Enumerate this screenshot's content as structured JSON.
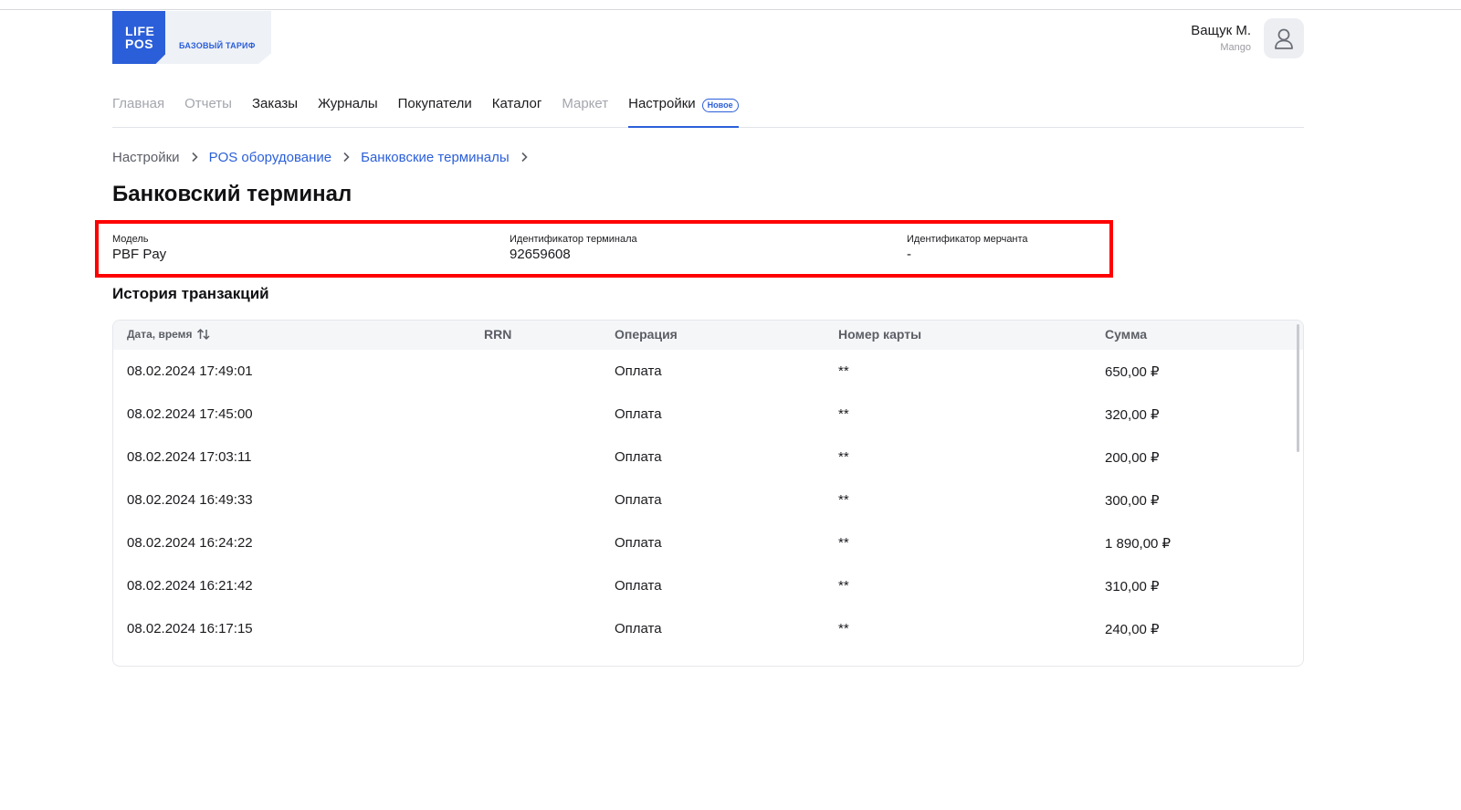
{
  "logo": {
    "line1": "LIFE",
    "line2": "POS",
    "tariff": "БАЗОВЫЙ ТАРИФ"
  },
  "user": {
    "name": "Ващук М.",
    "company": "Mango"
  },
  "nav": {
    "items": [
      {
        "label": "Главная"
      },
      {
        "label": "Отчеты"
      },
      {
        "label": "Заказы"
      },
      {
        "label": "Журналы"
      },
      {
        "label": "Покупатели"
      },
      {
        "label": "Каталог"
      },
      {
        "label": "Маркет"
      },
      {
        "label": "Настройки",
        "badge": "Новое"
      }
    ]
  },
  "breadcrumbs": [
    "Настройки",
    "POS оборудование",
    "Банковские терминалы"
  ],
  "page_title": "Банковский терминал",
  "info": {
    "model_label": "Модель",
    "model_value": "PBF Pay",
    "terminal_label": "Идентификатор терминала",
    "terminal_value": "92659608",
    "merchant_label": "Идентификатор мерчанта",
    "merchant_value": "-"
  },
  "history_title": "История транзакций",
  "table": {
    "headers": {
      "datetime": "Дата, время",
      "rrn": "RRN",
      "operation": "Операция",
      "card": "Номер карты",
      "amount": "Сумма"
    },
    "rows": [
      {
        "datetime": "08.02.2024 17:49:01",
        "rrn": "",
        "operation": "Оплата",
        "card": "**",
        "amount": "650,00 ₽"
      },
      {
        "datetime": "08.02.2024 17:45:00",
        "rrn": "",
        "operation": "Оплата",
        "card": "**",
        "amount": "320,00 ₽"
      },
      {
        "datetime": "08.02.2024 17:03:11",
        "rrn": "",
        "operation": "Оплата",
        "card": "**",
        "amount": "200,00 ₽"
      },
      {
        "datetime": "08.02.2024 16:49:33",
        "rrn": "",
        "operation": "Оплата",
        "card": "**",
        "amount": "300,00 ₽"
      },
      {
        "datetime": "08.02.2024 16:24:22",
        "rrn": "",
        "operation": "Оплата",
        "card": "**",
        "amount": "1 890,00 ₽"
      },
      {
        "datetime": "08.02.2024 16:21:42",
        "rrn": "",
        "operation": "Оплата",
        "card": "**",
        "amount": "310,00 ₽"
      },
      {
        "datetime": "08.02.2024 16:17:15",
        "rrn": "",
        "operation": "Оплата",
        "card": "**",
        "amount": "240,00 ₽"
      }
    ]
  },
  "colors": {
    "accent": "#2b5fd9",
    "highlight": "#ff0000",
    "muted": "#a4a6ad"
  }
}
